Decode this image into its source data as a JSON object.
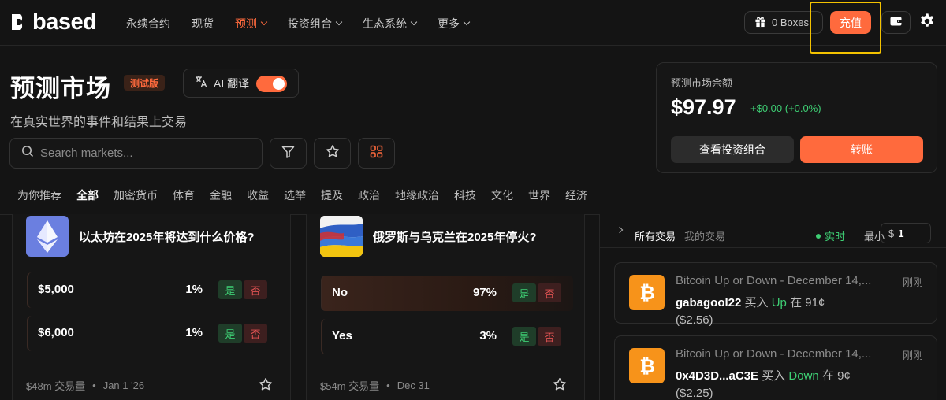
{
  "nav": {
    "logo_text": "based",
    "menu": [
      {
        "label": "永续合约",
        "active": false,
        "dropdown": false
      },
      {
        "label": "现货",
        "active": false,
        "dropdown": false
      },
      {
        "label": "预测",
        "active": true,
        "dropdown": true
      },
      {
        "label": "投资组合",
        "active": false,
        "dropdown": true
      },
      {
        "label": "生态系统",
        "active": false,
        "dropdown": true
      },
      {
        "label": "更多",
        "active": false,
        "dropdown": true
      }
    ],
    "boxes_label": "0 Boxes",
    "deposit_label": "充值"
  },
  "header": {
    "title": "预测市场",
    "beta_badge": "测试版",
    "ai_translate_label": "AI 翻译",
    "ai_translate_on": true,
    "subtitle": "在真实世界的事件和结果上交易",
    "search_placeholder": "Search markets..."
  },
  "balance": {
    "label": "预测市场余额",
    "amount": "$97.97",
    "change": "+$0.00 (+0.0%)",
    "portfolio_button": "查看投资组合",
    "transfer_button": "转账"
  },
  "categories": [
    {
      "label": "为你推荐",
      "active": false
    },
    {
      "label": "全部",
      "active": true
    },
    {
      "label": "加密货币",
      "active": false
    },
    {
      "label": "体育",
      "active": false
    },
    {
      "label": "金融",
      "active": false
    },
    {
      "label": "收益",
      "active": false
    },
    {
      "label": "选举",
      "active": false
    },
    {
      "label": "提及",
      "active": false
    },
    {
      "label": "政治",
      "active": false
    },
    {
      "label": "地缘政治",
      "active": false
    },
    {
      "label": "科技",
      "active": false
    },
    {
      "label": "文化",
      "active": false
    },
    {
      "label": "世界",
      "active": false
    },
    {
      "label": "经济",
      "active": false
    }
  ],
  "markets": [
    {
      "title": "以太坊在2025年将达到什么价格?",
      "outcomes": [
        {
          "name": "$5,000",
          "pct": "1%",
          "yes": "是",
          "no": "否"
        },
        {
          "name": "$6,000",
          "pct": "1%",
          "yes": "是",
          "no": "否"
        }
      ],
      "volume": "$48m 交易量",
      "date": "Jan 1 '26"
    },
    {
      "title": "俄罗斯与乌克兰在2025年停火?",
      "outcomes": [
        {
          "name": "No",
          "pct": "97%",
          "yes": "是",
          "no": "否"
        },
        {
          "name": "Yes",
          "pct": "3%",
          "yes": "是",
          "no": "否"
        }
      ],
      "volume": "$54m 交易量",
      "date": "Dec 31"
    }
  ],
  "trades_panel": {
    "all_label": "所有交易",
    "mine_label": "我的交易",
    "live_label": "实时",
    "min_label": "最小",
    "min_currency": "$",
    "min_value": "1",
    "trades": [
      {
        "title": "Bitcoin Up or Down - December 14,...",
        "time": "刚刚",
        "user": "gabagool22",
        "action": "买入",
        "side": "Up",
        "detail": "在 91¢ ($2.56)"
      },
      {
        "title": "Bitcoin Up or Down - December 14,...",
        "time": "刚刚",
        "user": "0x4D3D...aC3E",
        "action": "买入",
        "side": "Down",
        "detail": "在 9¢ ($2.25)"
      }
    ]
  },
  "colors": {
    "accent": "#ff6a3d",
    "positive": "#3ecf74",
    "negative": "#e05353",
    "highlight": "#f3c200"
  }
}
